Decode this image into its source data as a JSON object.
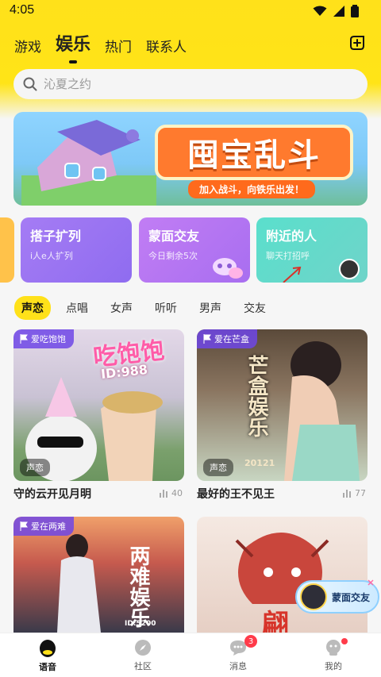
{
  "status": {
    "time": "4:05"
  },
  "tabs": [
    {
      "label": "游戏"
    },
    {
      "label": "娱乐"
    },
    {
      "label": "热门"
    },
    {
      "label": "联系人"
    }
  ],
  "search": {
    "placeholder": "沁夏之约"
  },
  "banner": {
    "title": "囤宝乱斗",
    "subtitle": "加入战斗，向铁乐出发！"
  },
  "features": [
    {
      "title": "搭子扩列",
      "subtitle": "i人e人扩列",
      "color": "#a57cf4"
    },
    {
      "title": "蒙面交友",
      "subtitle": "今日剩余5次",
      "color": "#b978f2"
    },
    {
      "title": "附近的人",
      "subtitle": "聊天打招呼",
      "color": "#4ed6c4"
    }
  ],
  "filters": [
    "声恋",
    "点唱",
    "女声",
    "听听",
    "男声",
    "交友"
  ],
  "rooms": [
    {
      "tag": "爱吃饱饱",
      "voice": "声恋",
      "name": "守的云开见月明",
      "count": "40",
      "art": "吃饱饱",
      "art2": "ID:988"
    },
    {
      "tag": "爱在芒盒",
      "voice": "声恋",
      "name": "最好的王不见王",
      "count": "77",
      "art": "芒盒娱乐",
      "art2": "20121"
    },
    {
      "tag": "爱在两难",
      "art": "两难娱乐",
      "art2": "ID:5200"
    },
    {
      "art": "翩"
    }
  ],
  "float_button": {
    "label": "蒙面交友"
  },
  "nav": [
    {
      "label": "语音"
    },
    {
      "label": "社区"
    },
    {
      "label": "消息",
      "badge": "3"
    },
    {
      "label": "我的"
    }
  ],
  "colors": {
    "brand_yellow": "#ffe11a",
    "badge_red": "#ff3b4a",
    "tag_purple": "#6e46e6"
  }
}
